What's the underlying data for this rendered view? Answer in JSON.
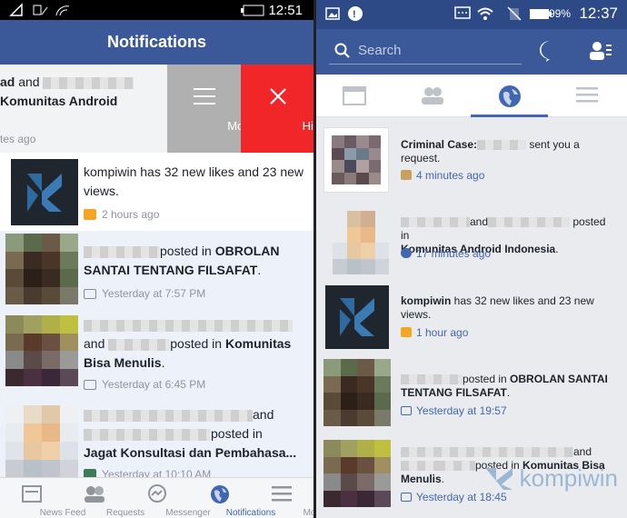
{
  "left": {
    "status_time": "12:51",
    "header_title": "Notifications",
    "swipe_item": {
      "line1_suffix": "and",
      "line2": "Komunitas Android",
      "time": "tes ago"
    },
    "swipe_actions": {
      "more": "More",
      "hide": "Hide"
    },
    "items": [
      {
        "text_a": "kompiwin",
        "text_b": " has 32 new likes and 23 new views.",
        "time": "2 hours ago"
      },
      {
        "text_a": "posted in ",
        "text_b": "OBROLAN SANTAI TENTANG FILSAFAT",
        "text_c": ".",
        "time": "Yesterday at 7:57 PM"
      },
      {
        "text_a": "and",
        "text_b": "posted in ",
        "text_c": "Komunitas Bisa Menulis",
        "text_d": ".",
        "time": "Yesterday at 6:45 PM"
      },
      {
        "text_a": "and",
        "text_b": "posted in",
        "text_c": "Jagat Konsultasi dan Pembahasa...",
        "time": "Yesterday at 10:10 AM"
      }
    ],
    "nav": [
      {
        "label": "News Feed",
        "icon": "news-feed-icon"
      },
      {
        "label": "Requests",
        "icon": "friend-requests-icon"
      },
      {
        "label": "Messenger",
        "icon": "messenger-icon"
      },
      {
        "label": "Notifications",
        "icon": "globe-icon"
      },
      {
        "label": "More",
        "icon": "menu-icon"
      }
    ]
  },
  "right": {
    "status_time": "12:37",
    "battery": "99%",
    "search_placeholder": "Search",
    "items": [
      {
        "bold": "Criminal Case:",
        "rest": "sent you a request.",
        "time": "4 minutes ago"
      },
      {
        "text_a": "and",
        "text_b": "posted in ",
        "bold": "Komunitas Android Indonesia",
        "text_c": ".",
        "time": "17 minutes ago"
      },
      {
        "bold": "kompiwin",
        "rest": " has 32 new likes and 23 new views.",
        "time": "1 hour ago"
      },
      {
        "text_a": "posted in ",
        "bold": "OBROLAN SANTAI TENTANG FILSAFAT",
        "text_c": ".",
        "time": "Yesterday at 19:57"
      },
      {
        "text_a": "and",
        "text_b": "posted in ",
        "bold": "Komunitas Bisa Menulis",
        "text_c": ".",
        "time": "Yesterday at 18:45"
      }
    ],
    "watermark": "kompiwin"
  }
}
